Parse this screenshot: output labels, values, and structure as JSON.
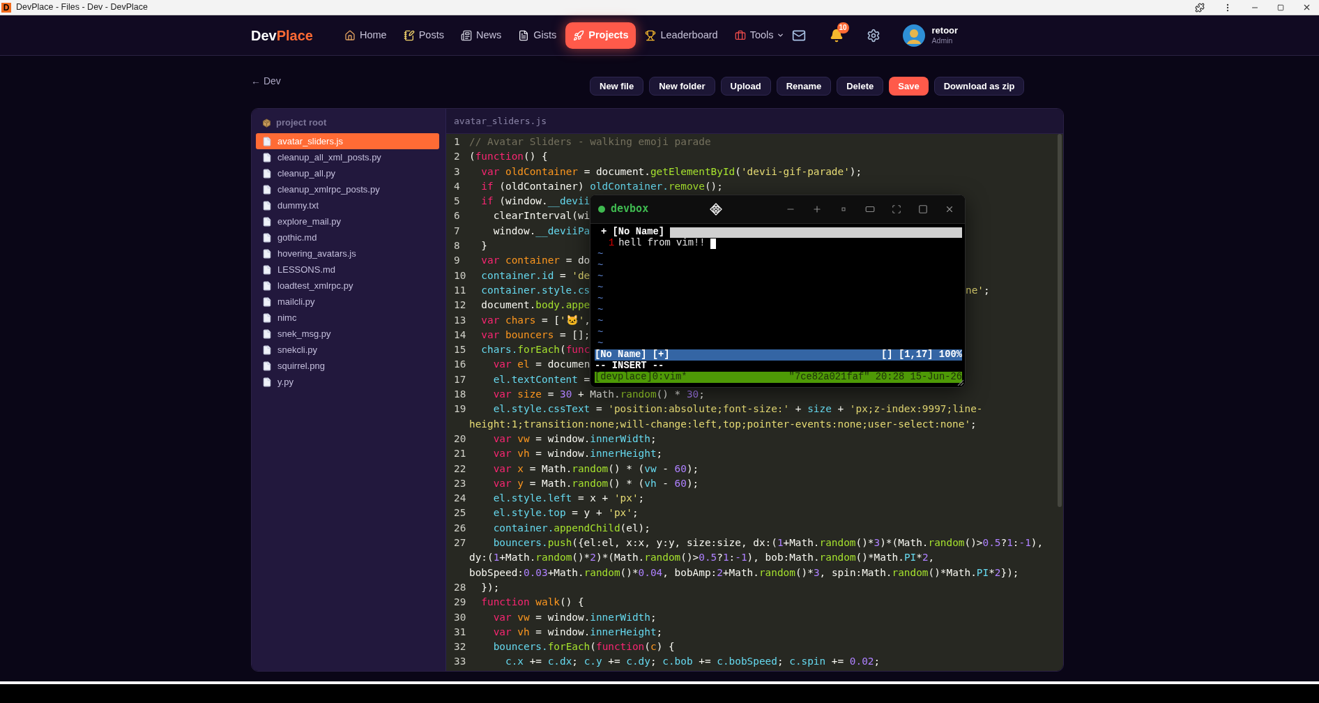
{
  "browser": {
    "favicon": "D",
    "title": "DevPlace - Files - Dev - DevPlace"
  },
  "nav": {
    "logo": {
      "first": "Dev",
      "second": "Place"
    },
    "items": [
      {
        "label": "Home",
        "selected": false,
        "dropdown": false
      },
      {
        "label": "Posts",
        "selected": false,
        "dropdown": false
      },
      {
        "label": "News",
        "selected": false,
        "dropdown": false
      },
      {
        "label": "Gists",
        "selected": false,
        "dropdown": false
      },
      {
        "label": "Projects",
        "selected": true,
        "dropdown": false
      },
      {
        "label": "Leaderboard",
        "selected": false,
        "dropdown": false
      },
      {
        "label": "Tools",
        "selected": false,
        "dropdown": true
      }
    ],
    "notification_count": "10",
    "user": {
      "name": "retoor",
      "role": "Admin"
    }
  },
  "breadcrumb": "← Dev",
  "actions": [
    {
      "label": "New file",
      "primary": false
    },
    {
      "label": "New folder",
      "primary": false
    },
    {
      "label": "Upload",
      "primary": false
    },
    {
      "label": "Rename",
      "primary": false
    },
    {
      "label": "Delete",
      "primary": false
    },
    {
      "label": "Save",
      "primary": true
    },
    {
      "label": "Download as zip",
      "primary": false
    }
  ],
  "file_tree": {
    "root": "project root",
    "files": [
      {
        "name": "avatar_sliders.js",
        "selected": true
      },
      {
        "name": "cleanup_all_xml_posts.py",
        "selected": false
      },
      {
        "name": "cleanup_all.py",
        "selected": false
      },
      {
        "name": "cleanup_xmlrpc_posts.py",
        "selected": false
      },
      {
        "name": "dummy.txt",
        "selected": false
      },
      {
        "name": "explore_mail.py",
        "selected": false
      },
      {
        "name": "gothic.md",
        "selected": false
      },
      {
        "name": "hovering_avatars.js",
        "selected": false
      },
      {
        "name": "LESSONS.md",
        "selected": false
      },
      {
        "name": "loadtest_xmlrpc.py",
        "selected": false
      },
      {
        "name": "mailcli.py",
        "selected": false
      },
      {
        "name": "nimc",
        "selected": false
      },
      {
        "name": "snek_msg.py",
        "selected": false
      },
      {
        "name": "snekcli.py",
        "selected": false
      },
      {
        "name": "squirrel.png",
        "selected": false
      },
      {
        "name": "y.py",
        "selected": false
      }
    ]
  },
  "editor": {
    "filename": "avatar_sliders.js",
    "lines": [
      {
        "number": "1",
        "tokens": [
          {
            "kind": "cmt",
            "text": "// Avatar Sliders - walking emoji parade"
          }
        ]
      },
      {
        "number": "2",
        "tokens": [
          {
            "kind": "txt",
            "text": "("
          },
          {
            "kind": "kw",
            "text": "function"
          },
          {
            "kind": "txt",
            "text": "() {"
          }
        ]
      },
      {
        "number": "3",
        "tokens": [
          {
            "kind": "kw",
            "text": "  var"
          },
          {
            "kind": "decl",
            "text": " oldContainer"
          },
          {
            "kind": "txt",
            "text": " = document."
          },
          {
            "kind": "call",
            "text": "getElementById"
          },
          {
            "kind": "txt",
            "text": "("
          },
          {
            "kind": "str",
            "text": "'devii-gif-parade'"
          },
          {
            "kind": "txt",
            "text": ");"
          }
        ]
      },
      {
        "number": "4",
        "tokens": [
          {
            "kind": "kw",
            "text": "  if"
          },
          {
            "kind": "txt",
            "text": " (oldContainer) "
          },
          {
            "kind": "prop",
            "text": "oldContainer."
          },
          {
            "kind": "call",
            "text": "remove"
          },
          {
            "kind": "txt",
            "text": "();"
          }
        ]
      },
      {
        "number": "5",
        "tokens": [
          {
            "kind": "kw",
            "text": "  if"
          },
          {
            "kind": "txt",
            "text": " (window."
          },
          {
            "kind": "prop",
            "text": "__devii"
          }
        ]
      },
      {
        "number": "6",
        "tokens": [
          {
            "kind": "txt",
            "text": "    clearInterval(wi"
          }
        ]
      },
      {
        "number": "7",
        "tokens": [
          {
            "kind": "txt",
            "text": "    window."
          },
          {
            "kind": "prop",
            "text": "__deviiPa"
          }
        ]
      },
      {
        "number": "8",
        "tokens": [
          {
            "kind": "txt",
            "text": "  }"
          }
        ]
      },
      {
        "number": "9",
        "tokens": [
          {
            "kind": "kw",
            "text": "  var"
          },
          {
            "kind": "decl",
            "text": " container"
          },
          {
            "kind": "txt",
            "text": " = do"
          }
        ]
      },
      {
        "number": "10",
        "tokens": [
          {
            "kind": "prop",
            "text": "  container.id"
          },
          {
            "kind": "txt",
            "text": " = "
          },
          {
            "kind": "str",
            "text": "'de"
          }
        ]
      },
      {
        "number": "11",
        "tokens": [
          {
            "kind": "prop",
            "text": "  container.style.cs"
          }
        ],
        "tail": [
          {
            "kind": "str",
            "text": "ne'"
          },
          {
            "kind": "txt",
            "text": ";"
          }
        ]
      },
      {
        "number": "12",
        "tokens": [
          {
            "kind": "txt",
            "text": "  document."
          },
          {
            "kind": "call",
            "text": "body.appe"
          }
        ]
      },
      {
        "number": "13",
        "tokens": [
          {
            "kind": "kw",
            "text": "  var"
          },
          {
            "kind": "decl",
            "text": " chars"
          },
          {
            "kind": "txt",
            "text": " = ["
          },
          {
            "kind": "str",
            "text": "'🐱'"
          },
          {
            "kind": "txt",
            "text": ","
          }
        ]
      },
      {
        "number": "14",
        "tokens": [
          {
            "kind": "kw",
            "text": "  var"
          },
          {
            "kind": "decl",
            "text": " bouncers"
          },
          {
            "kind": "txt",
            "text": " = [];"
          }
        ]
      },
      {
        "number": "15",
        "tokens": [
          {
            "kind": "prop",
            "text": "  chars."
          },
          {
            "kind": "call",
            "text": "forEach"
          },
          {
            "kind": "txt",
            "text": "("
          },
          {
            "kind": "kw",
            "text": "func"
          }
        ]
      },
      {
        "number": "16",
        "tokens": [
          {
            "kind": "kw",
            "text": "    var"
          },
          {
            "kind": "decl",
            "text": " el"
          },
          {
            "kind": "txt",
            "text": " = documen"
          }
        ]
      },
      {
        "number": "17",
        "tokens": [
          {
            "kind": "prop",
            "text": "    el.textContent"
          },
          {
            "kind": "txt",
            "text": " ="
          }
        ]
      },
      {
        "number": "18",
        "tokens": [
          {
            "kind": "kw",
            "text": "    var"
          },
          {
            "kind": "decl",
            "text": " size"
          },
          {
            "kind": "txt",
            "text": " = "
          },
          {
            "kind": "num",
            "text": "30"
          },
          {
            "kind": "txt",
            "text": " + Math."
          },
          {
            "kind": "call",
            "text": "random"
          },
          {
            "kind": "txt",
            "text": "() * "
          },
          {
            "kind": "num",
            "text": "30"
          },
          {
            "kind": "txt",
            "text": ";"
          }
        ]
      },
      {
        "number": "19",
        "tokens": [
          {
            "kind": "prop",
            "text": "    el.style.cssText"
          },
          {
            "kind": "txt",
            "text": " = "
          },
          {
            "kind": "str",
            "text": "'position:absolute;font-size:'"
          },
          {
            "kind": "txt",
            "text": " + "
          },
          {
            "kind": "prop",
            "text": "size"
          },
          {
            "kind": "txt",
            "text": " + "
          },
          {
            "kind": "str",
            "text": "'px;z-index:9997;line-height:1;transition:none;will-change:left,top;pointer-events:none;user-select:none'"
          },
          {
            "kind": "txt",
            "text": ";"
          }
        ]
      },
      {
        "number": "20",
        "tokens": [
          {
            "kind": "kw",
            "text": "    var"
          },
          {
            "kind": "decl",
            "text": " vw"
          },
          {
            "kind": "txt",
            "text": " = window."
          },
          {
            "kind": "prop",
            "text": "innerWidth"
          },
          {
            "kind": "txt",
            "text": ";"
          }
        ]
      },
      {
        "number": "21",
        "tokens": [
          {
            "kind": "kw",
            "text": "    var"
          },
          {
            "kind": "decl",
            "text": " vh"
          },
          {
            "kind": "txt",
            "text": " = window."
          },
          {
            "kind": "prop",
            "text": "innerHeight"
          },
          {
            "kind": "txt",
            "text": ";"
          }
        ]
      },
      {
        "number": "22",
        "tokens": [
          {
            "kind": "kw",
            "text": "    var"
          },
          {
            "kind": "decl",
            "text": " x"
          },
          {
            "kind": "txt",
            "text": " = Math."
          },
          {
            "kind": "call",
            "text": "random"
          },
          {
            "kind": "txt",
            "text": "() * ("
          },
          {
            "kind": "prop",
            "text": "vw"
          },
          {
            "kind": "txt",
            "text": " - "
          },
          {
            "kind": "num",
            "text": "60"
          },
          {
            "kind": "txt",
            "text": ");"
          }
        ]
      },
      {
        "number": "23",
        "tokens": [
          {
            "kind": "kw",
            "text": "    var"
          },
          {
            "kind": "decl",
            "text": " y"
          },
          {
            "kind": "txt",
            "text": " = Math."
          },
          {
            "kind": "call",
            "text": "random"
          },
          {
            "kind": "txt",
            "text": "() * ("
          },
          {
            "kind": "prop",
            "text": "vh"
          },
          {
            "kind": "txt",
            "text": " - "
          },
          {
            "kind": "num",
            "text": "60"
          },
          {
            "kind": "txt",
            "text": ");"
          }
        ]
      },
      {
        "number": "24",
        "tokens": [
          {
            "kind": "prop",
            "text": "    el.style.left"
          },
          {
            "kind": "txt",
            "text": " = x + "
          },
          {
            "kind": "str",
            "text": "'px'"
          },
          {
            "kind": "txt",
            "text": ";"
          }
        ]
      },
      {
        "number": "25",
        "tokens": [
          {
            "kind": "prop",
            "text": "    el.style.top"
          },
          {
            "kind": "txt",
            "text": " = y + "
          },
          {
            "kind": "str",
            "text": "'px'"
          },
          {
            "kind": "txt",
            "text": ";"
          }
        ]
      },
      {
        "number": "26",
        "tokens": [
          {
            "kind": "prop",
            "text": "    container."
          },
          {
            "kind": "call",
            "text": "appendChild"
          },
          {
            "kind": "txt",
            "text": "(el);"
          }
        ]
      },
      {
        "number": "27",
        "tokens": [
          {
            "kind": "prop",
            "text": "    bouncers."
          },
          {
            "kind": "call",
            "text": "push"
          },
          {
            "kind": "txt",
            "text": "({el:el, x:x, y:y, size:size, dx:("
          },
          {
            "kind": "num",
            "text": "1"
          },
          {
            "kind": "txt",
            "text": "+Math."
          },
          {
            "kind": "call",
            "text": "random"
          },
          {
            "kind": "txt",
            "text": "()*"
          },
          {
            "kind": "num",
            "text": "3"
          },
          {
            "kind": "txt",
            "text": ")*(Math."
          },
          {
            "kind": "call",
            "text": "random"
          },
          {
            "kind": "txt",
            "text": "()>"
          },
          {
            "kind": "num",
            "text": "0.5"
          },
          {
            "kind": "txt",
            "text": "?"
          },
          {
            "kind": "num",
            "text": "1"
          },
          {
            "kind": "txt",
            "text": ":"
          },
          {
            "kind": "num",
            "text": "-1"
          },
          {
            "kind": "txt",
            "text": "), dy:("
          },
          {
            "kind": "num",
            "text": "1"
          },
          {
            "kind": "txt",
            "text": "+Math."
          },
          {
            "kind": "call",
            "text": "random"
          },
          {
            "kind": "txt",
            "text": "()*"
          },
          {
            "kind": "num",
            "text": "2"
          },
          {
            "kind": "txt",
            "text": ")*(Math."
          },
          {
            "kind": "call",
            "text": "random"
          },
          {
            "kind": "txt",
            "text": "()>"
          },
          {
            "kind": "num",
            "text": "0.5"
          },
          {
            "kind": "txt",
            "text": "?"
          },
          {
            "kind": "num",
            "text": "1"
          },
          {
            "kind": "txt",
            "text": ":"
          },
          {
            "kind": "num",
            "text": "-1"
          },
          {
            "kind": "txt",
            "text": "), bob:Math."
          },
          {
            "kind": "call",
            "text": "random"
          },
          {
            "kind": "txt",
            "text": "()*Math."
          },
          {
            "kind": "prop",
            "text": "PI"
          },
          {
            "kind": "txt",
            "text": "*"
          },
          {
            "kind": "num",
            "text": "2"
          },
          {
            "kind": "txt",
            "text": ", bobSpeed:"
          },
          {
            "kind": "num",
            "text": "0.03"
          },
          {
            "kind": "txt",
            "text": "+Math."
          },
          {
            "kind": "call",
            "text": "random"
          },
          {
            "kind": "txt",
            "text": "()*"
          },
          {
            "kind": "num",
            "text": "0.04"
          },
          {
            "kind": "txt",
            "text": ", bobAmp:"
          },
          {
            "kind": "num",
            "text": "2"
          },
          {
            "kind": "txt",
            "text": "+Math."
          },
          {
            "kind": "call",
            "text": "random"
          },
          {
            "kind": "txt",
            "text": "()*"
          },
          {
            "kind": "num",
            "text": "3"
          },
          {
            "kind": "txt",
            "text": ", spin:Math."
          },
          {
            "kind": "call",
            "text": "random"
          },
          {
            "kind": "txt",
            "text": "()*Math."
          },
          {
            "kind": "prop",
            "text": "PI"
          },
          {
            "kind": "txt",
            "text": "*"
          },
          {
            "kind": "num",
            "text": "2"
          },
          {
            "kind": "txt",
            "text": "});"
          }
        ]
      },
      {
        "number": "28",
        "tokens": [
          {
            "kind": "txt",
            "text": "  });"
          }
        ]
      },
      {
        "number": "29",
        "tokens": [
          {
            "kind": "kw",
            "text": "  function"
          },
          {
            "kind": "decl",
            "text": " walk"
          },
          {
            "kind": "txt",
            "text": "() {"
          }
        ]
      },
      {
        "number": "30",
        "tokens": [
          {
            "kind": "kw",
            "text": "    var"
          },
          {
            "kind": "decl",
            "text": " vw"
          },
          {
            "kind": "txt",
            "text": " = window."
          },
          {
            "kind": "prop",
            "text": "innerWidth"
          },
          {
            "kind": "txt",
            "text": ";"
          }
        ]
      },
      {
        "number": "31",
        "tokens": [
          {
            "kind": "kw",
            "text": "    var"
          },
          {
            "kind": "decl",
            "text": " vh"
          },
          {
            "kind": "txt",
            "text": " = window."
          },
          {
            "kind": "prop",
            "text": "innerHeight"
          },
          {
            "kind": "txt",
            "text": ";"
          }
        ]
      },
      {
        "number": "32",
        "tokens": [
          {
            "kind": "prop",
            "text": "    bouncers."
          },
          {
            "kind": "call",
            "text": "forEach"
          },
          {
            "kind": "txt",
            "text": "("
          },
          {
            "kind": "kw",
            "text": "function"
          },
          {
            "kind": "txt",
            "text": "("
          },
          {
            "kind": "decl",
            "text": "c"
          },
          {
            "kind": "txt",
            "text": ") {"
          }
        ]
      },
      {
        "number": "33",
        "tokens": [
          {
            "kind": "prop",
            "text": "      c.x"
          },
          {
            "kind": "txt",
            "text": " += "
          },
          {
            "kind": "prop",
            "text": "c.dx"
          },
          {
            "kind": "txt",
            "text": "; "
          },
          {
            "kind": "prop",
            "text": "c.y"
          },
          {
            "kind": "txt",
            "text": " += "
          },
          {
            "kind": "prop",
            "text": "c.dy"
          },
          {
            "kind": "txt",
            "text": "; "
          },
          {
            "kind": "prop",
            "text": "c.bob"
          },
          {
            "kind": "txt",
            "text": " += "
          },
          {
            "kind": "prop",
            "text": "c.bobSpeed"
          },
          {
            "kind": "txt",
            "text": "; "
          },
          {
            "kind": "prop",
            "text": "c.spin"
          },
          {
            "kind": "txt",
            "text": " += "
          },
          {
            "kind": "num",
            "text": "0.02"
          },
          {
            "kind": "txt",
            "text": ";"
          }
        ]
      }
    ]
  },
  "terminal": {
    "title": "devbox",
    "tabline": "+ [No Name]",
    "buffer_lines": [
      {
        "number": "1",
        "text": "hell from vim!!"
      }
    ],
    "empty_markers": [
      "~",
      "~",
      "~",
      "~",
      "~",
      "~",
      "~",
      "~",
      "~"
    ],
    "statusline": {
      "left": "[No Name] [+]",
      "right": "[] [1,17] 100%"
    },
    "mode": "-- INSERT --",
    "tmux": {
      "left": "[devplace]0:vim*",
      "right": "\"7ce82a021faf\" 20:28 15-Jun-26"
    }
  }
}
